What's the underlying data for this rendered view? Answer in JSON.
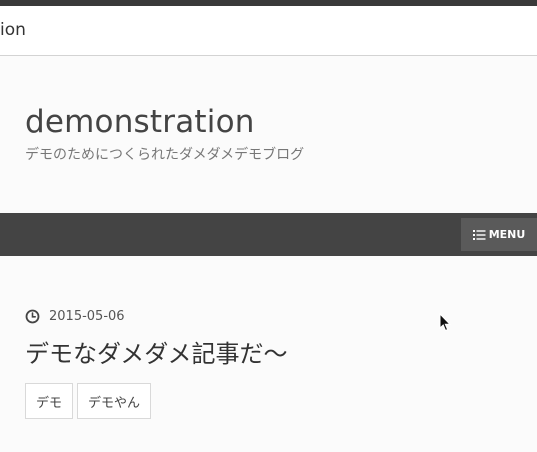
{
  "browser": {
    "address_partial": "ion"
  },
  "site": {
    "title": "demonstration",
    "tagline": "デモのためにつくられたダメダメデモブログ"
  },
  "nav": {
    "menu_label": "MENU",
    "menu_icon": "list-icon"
  },
  "post": {
    "date": "2015-05-06",
    "date_icon": "clock-icon",
    "title": "デモなダメダメ記事だ〜",
    "tags": [
      "デモ",
      "デモやん"
    ]
  },
  "colors": {
    "navbar": "#444444",
    "menu_button": "#5a5a5a",
    "background": "#fbfbfb"
  }
}
